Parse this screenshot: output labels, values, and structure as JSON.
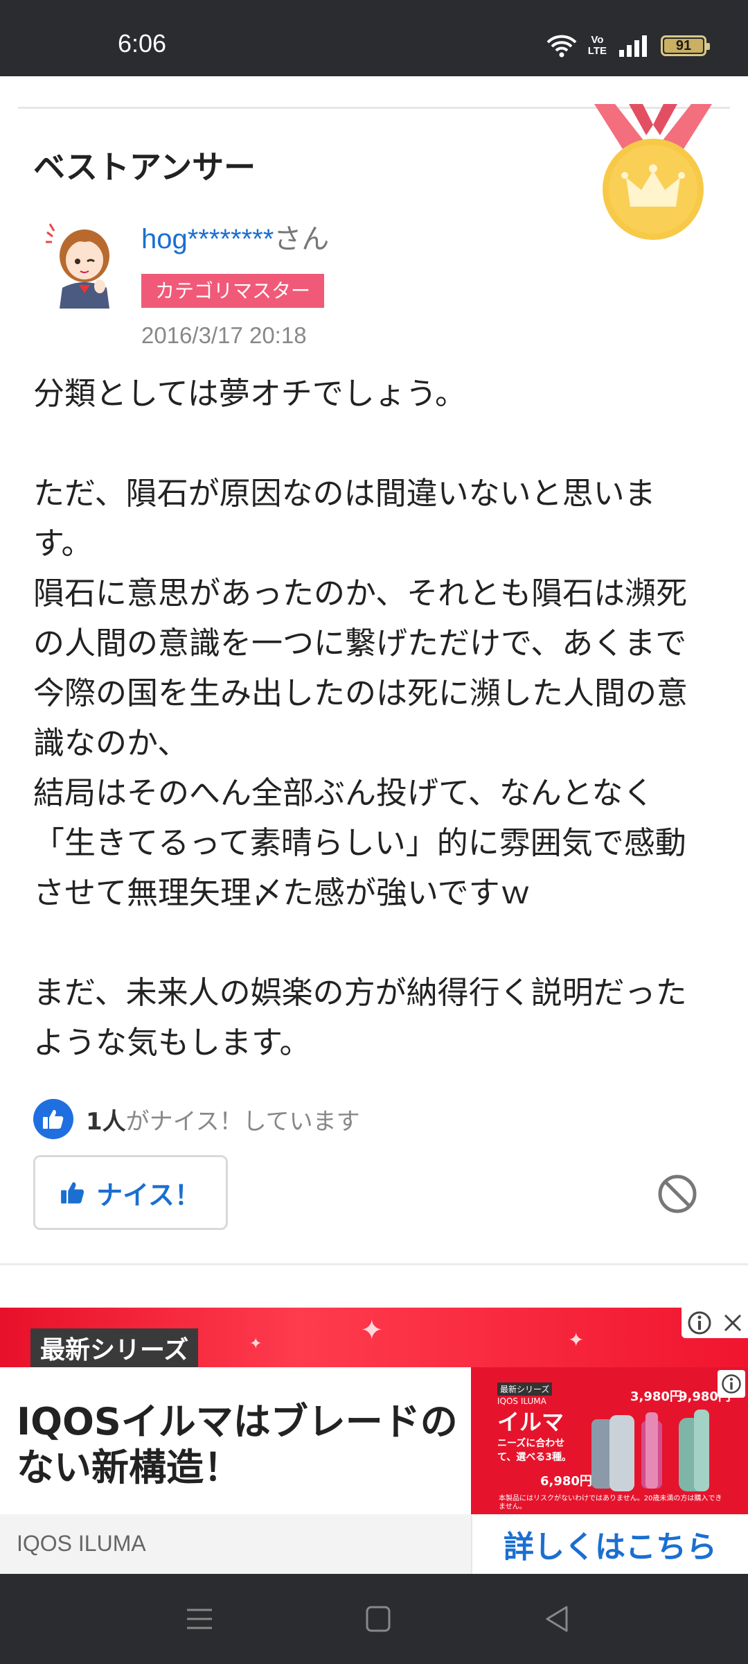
{
  "status_bar": {
    "time": "6:06",
    "network_label_top": "Vo",
    "network_label_bottom": "LTE",
    "battery_level": "91"
  },
  "answer": {
    "heading": "ベストアンサー",
    "user_name": "hog********",
    "user_suffix": "さん",
    "badge": "カテゴリマスター",
    "date": "2016/3/17 20:18",
    "body": "分類としては夢オチでしょう。\n\nただ、隕石が原因なのは間違いないと思います。\n隕石に意思があったのか、それとも隕石は瀕死の人間の意識を一つに繋げただけで、あくまで今際の国を生み出したのは死に瀕した人間の意識なのか、\n結局はそのへん全部ぶん投げて、なんとなく「生きてるって素晴らしい」的に雰囲気で感動させて無理矢理〆た感が強いですｗ\n\nまだ、未来人の娯楽の方が納得行く説明だったような気もします。",
    "nice_count_number": "1人",
    "nice_count_text": "がナイス！しています",
    "nice_button_label": "ナイス！"
  },
  "ad": {
    "banner_tag": "最新シリーズ",
    "headline": "IQOSイルマはブレードのない新構造！",
    "brand": "IQOS ILUMA",
    "cta": "詳しくはこちら",
    "image_text": {
      "tag": "最新シリーズ",
      "brand_small": "IQOS ILUMA",
      "title": "イルマ",
      "tagline": "ニーズに合わせて、選べる3種。",
      "price_one": "6,980円",
      "price_prime": "3,980円",
      "price_top": "9,980円",
      "disclaimer": "本製品にはリスクがないわけではありません。20歳未満の方は購入できません。"
    }
  },
  "colors": {
    "link_blue": "#1a6fd1",
    "badge_pink": "#f05a78",
    "ad_red": "#e5142c",
    "medal_gold": "#f7c948"
  },
  "icons": {
    "nice": "thumbs-up-icon",
    "report": "block-icon",
    "ad_info": "info-icon",
    "ad_close": "close-icon"
  }
}
